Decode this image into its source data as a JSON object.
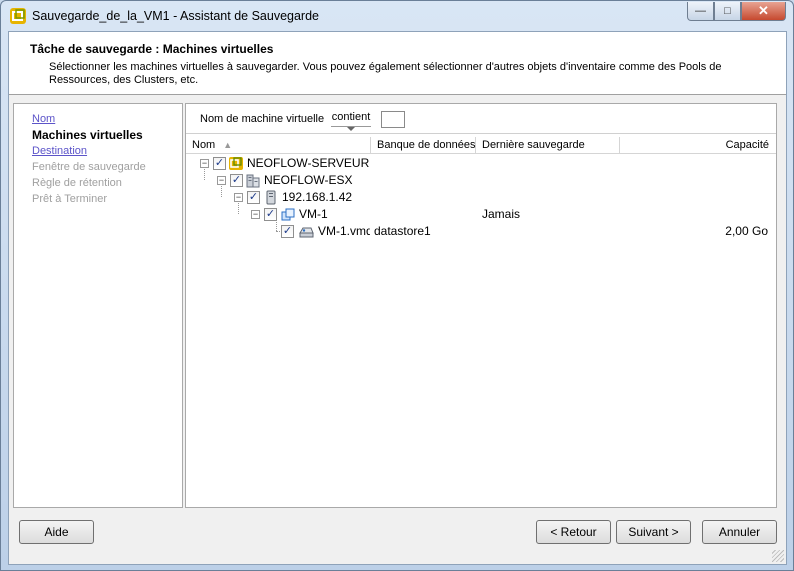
{
  "window": {
    "title": "Sauvegarde_de_la_VM1 - Assistant de Sauvegarde",
    "icon": "vmware-backup-icon",
    "buttons": {
      "minimize": "—",
      "maximize": "□",
      "close": "✕"
    }
  },
  "header": {
    "title": "Tâche de sauvegarde : Machines virtuelles",
    "description": "Sélectionner les machines virtuelles à sauvegarder. Vous pouvez également sélectionner d'autres objets d'inventaire comme des Pools de Ressources, des Clusters, etc."
  },
  "steps": [
    {
      "label": "Nom",
      "state": "link"
    },
    {
      "label": "Machines virtuelles",
      "state": "current"
    },
    {
      "label": "Destination",
      "state": "link"
    },
    {
      "label": "Fenêtre de sauvegarde",
      "state": "disabled"
    },
    {
      "label": "Règle de rétention",
      "state": "disabled"
    },
    {
      "label": "Prêt à Terminer",
      "state": "disabled"
    }
  ],
  "filter": {
    "label": "Nom de machine virtuelle",
    "operator": "contient",
    "value": ""
  },
  "columns": [
    "Nom",
    "Banque de données",
    "Dernière sauvegarde",
    "Capacité"
  ],
  "tree": [
    {
      "name": "NEOFLOW-SERVEUR",
      "level": 0,
      "icon": "vcenter-server-icon",
      "checked": true,
      "expanded": true,
      "datastore": "",
      "last_backup": "",
      "capacity": ""
    },
    {
      "name": "NEOFLOW-ESX",
      "level": 1,
      "icon": "datacenter-icon",
      "checked": true,
      "expanded": true,
      "datastore": "",
      "last_backup": "",
      "capacity": ""
    },
    {
      "name": "192.168.1.42",
      "level": 2,
      "icon": "host-icon",
      "checked": true,
      "expanded": true,
      "datastore": "",
      "last_backup": "",
      "capacity": ""
    },
    {
      "name": "VM-1",
      "level": 3,
      "icon": "virtual-machine-icon",
      "checked": true,
      "expanded": true,
      "datastore": "",
      "last_backup": "Jamais",
      "capacity": ""
    },
    {
      "name": "VM-1.vmdk",
      "level": 4,
      "icon": "virtual-disk-icon",
      "checked": true,
      "expanded": null,
      "datastore": "datastore1",
      "last_backup": "",
      "capacity": "2,00 Go"
    }
  ],
  "buttons": {
    "help": "Aide",
    "back": "< Retour",
    "next": "Suivant >",
    "cancel": "Annuler"
  },
  "colors": {
    "link": "#5c54c9",
    "disabled": "#a0a0a0"
  }
}
